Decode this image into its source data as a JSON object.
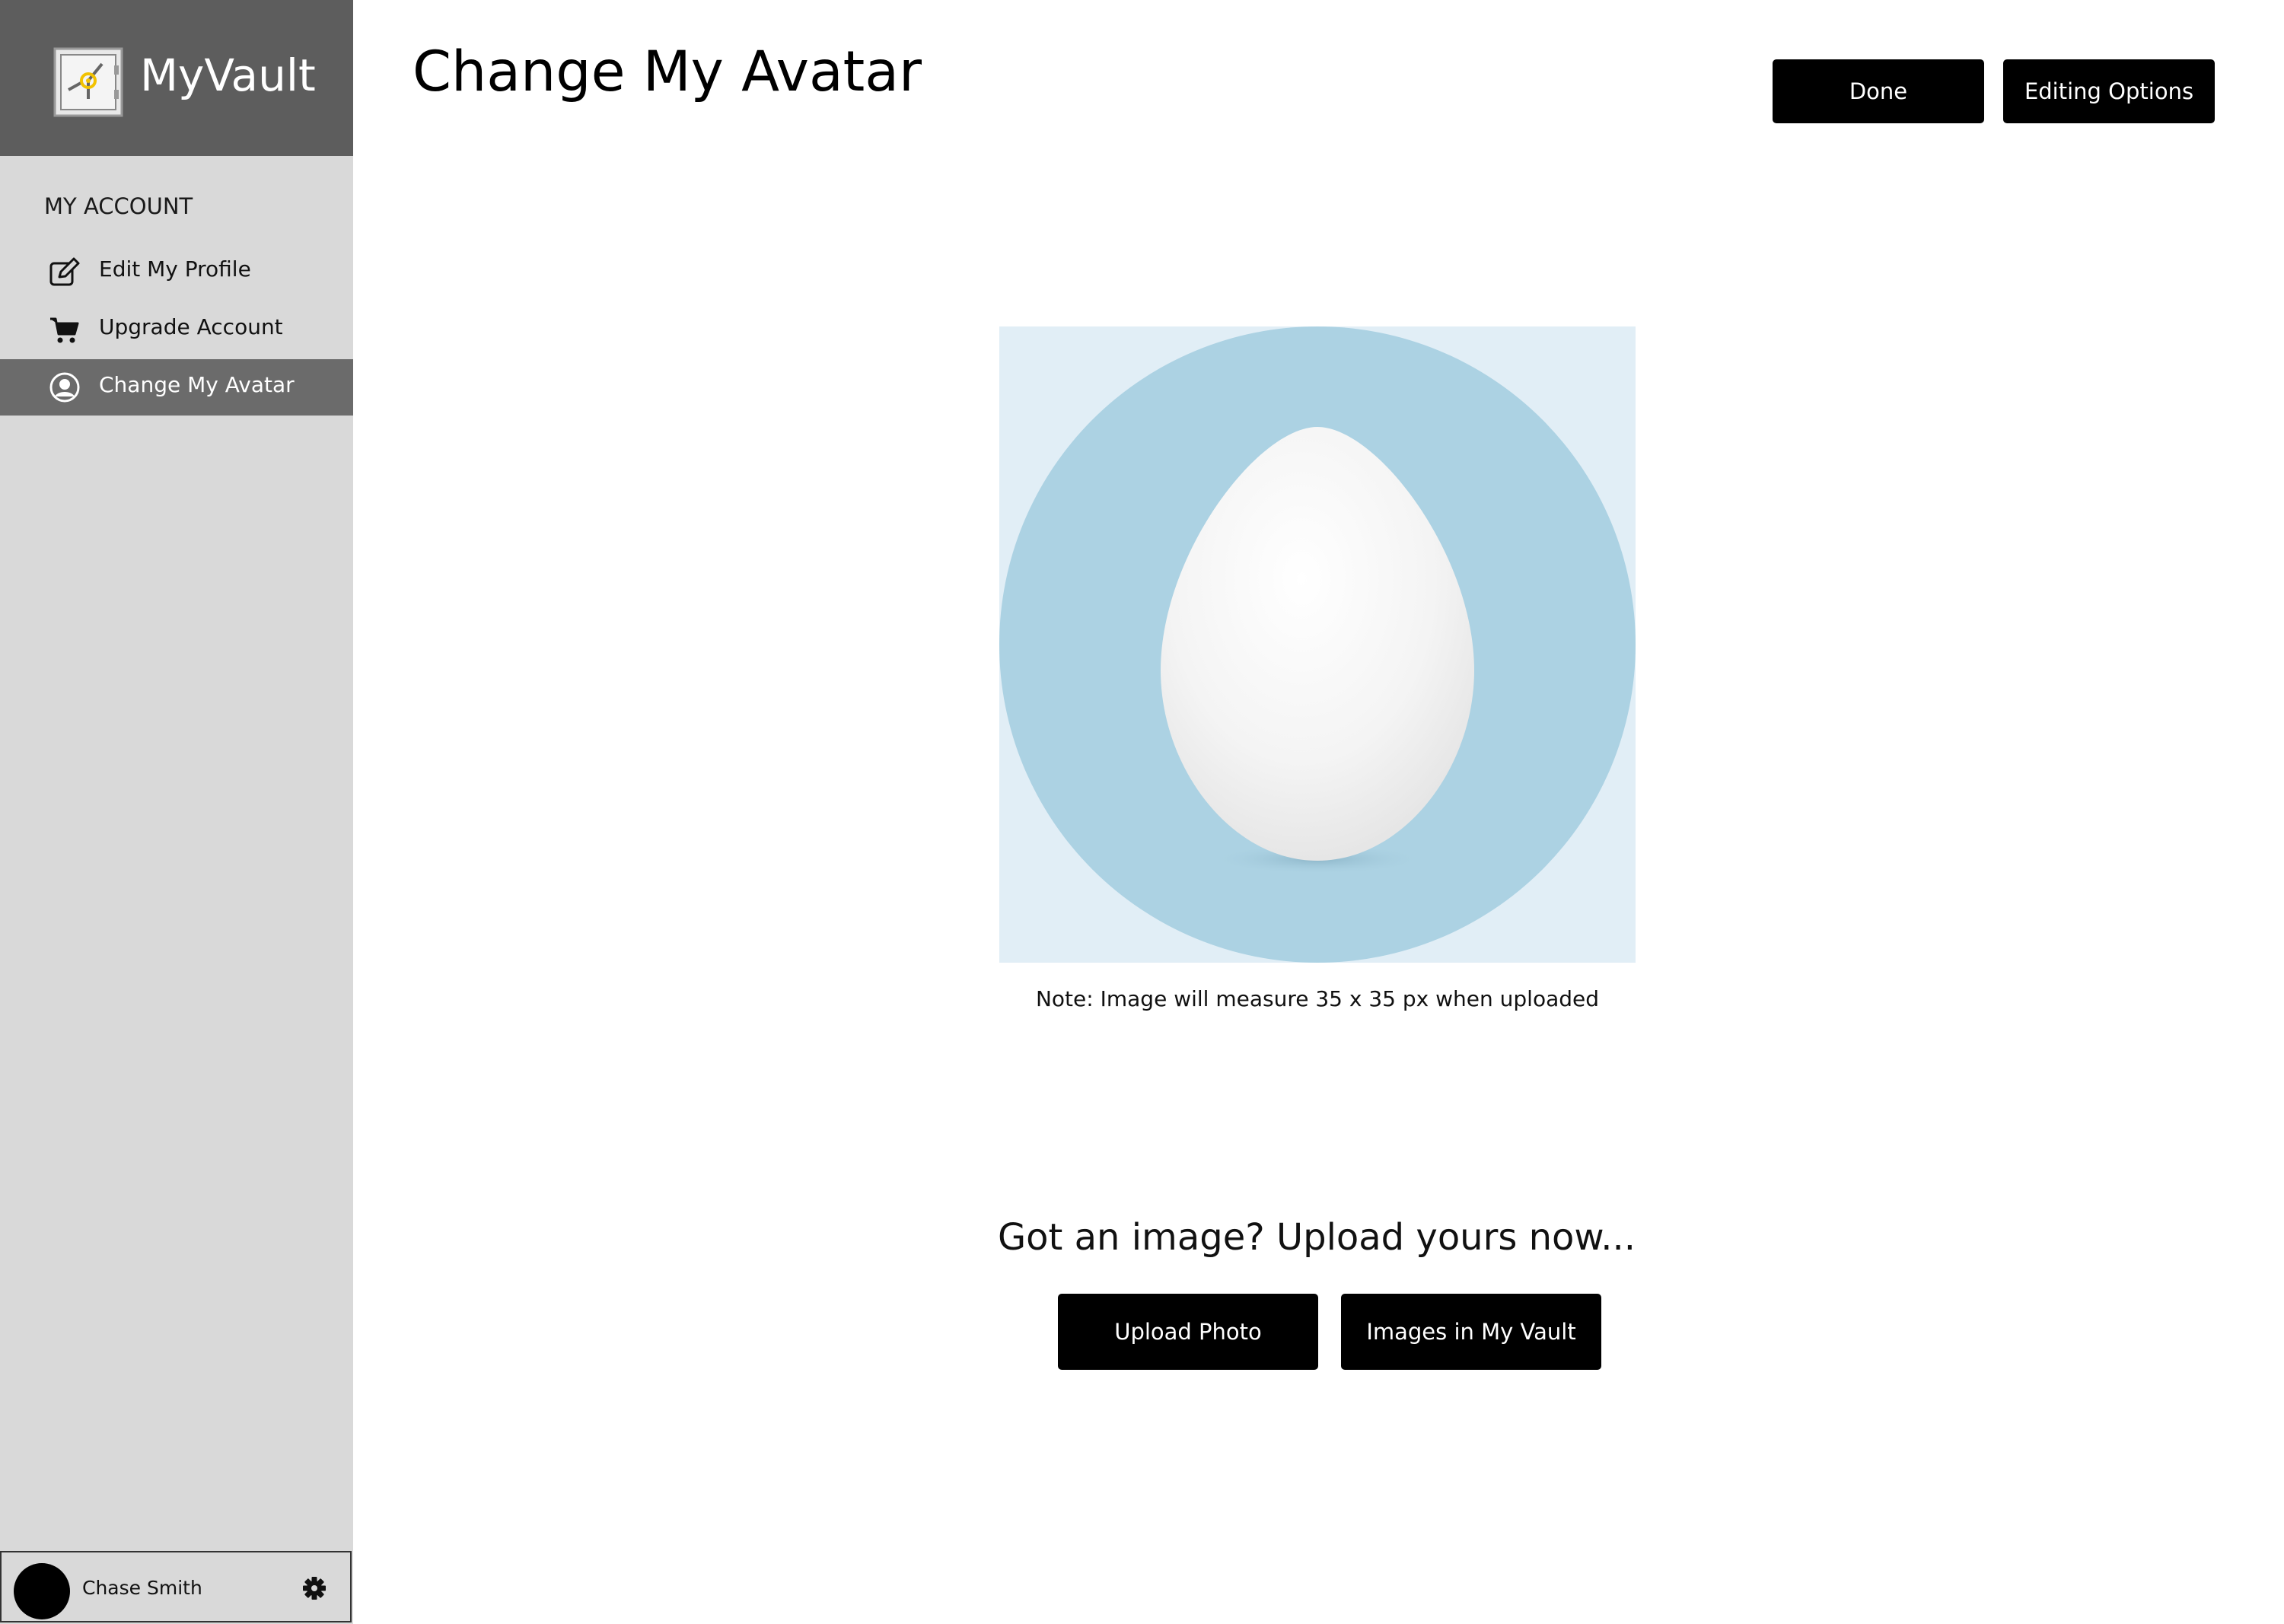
{
  "app": {
    "name": "MyVault"
  },
  "sidebar": {
    "section_heading": "MY ACCOUNT",
    "items": [
      {
        "label": "Edit My Profile",
        "icon": "edit-icon",
        "active": false
      },
      {
        "label": "Upgrade Account",
        "icon": "cart-icon",
        "active": false
      },
      {
        "label": "Change My Avatar",
        "icon": "user-circle-icon",
        "active": true
      }
    ]
  },
  "user": {
    "name": "Chase Smith",
    "settings_icon": "gear-icon"
  },
  "header": {
    "title": "Change My Avatar",
    "done_label": "Done",
    "editing_options_label": "Editing Options"
  },
  "avatar_preview": {
    "note": "Note: Image will measure 35 x 35 px when uploaded",
    "background_color": "#e1eef6",
    "circle_color": "#acd2e3",
    "content": "egg"
  },
  "upload": {
    "heading": "Got an image? Upload yours now...",
    "upload_label": "Upload Photo",
    "vault_label": "Images in My Vault"
  },
  "colors": {
    "sidebar_bg": "#d9d9d9",
    "brand_bg": "#5d5d5d",
    "active_item_bg": "#6b6b6b",
    "button_bg": "#000000",
    "button_text": "#ffffff"
  }
}
